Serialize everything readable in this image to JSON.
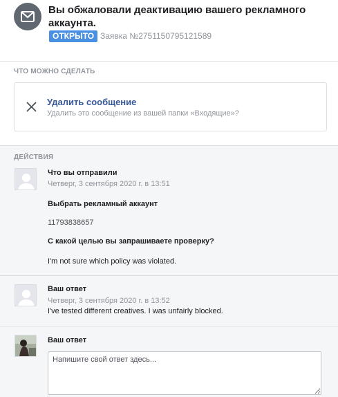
{
  "header": {
    "title": "Вы обжаловали деактивацию вашего рекламного аккаунта.",
    "status": "ОТКРЫТО",
    "ticket_id": "Заявка №2751150795121589",
    "icon": "envelope-icon"
  },
  "what_to_do": {
    "section_label": "ЧТО МОЖНО СДЕЛАТЬ",
    "action_title": "Удалить сообщение",
    "action_description": "Удалить это сообщение из вашей папки «Входящие»?",
    "icon": "close-icon"
  },
  "actions": {
    "section_label": "ДЕЙСТВИЯ",
    "messages": [
      {
        "author": "Что вы отправили",
        "time": "Четверг, 3 сентября 2020 г. в 13:51",
        "field_label": "Выбрать рекламный аккаунт",
        "account_id": "11793838657",
        "question": "С какой целью вы запрашиваете проверку?",
        "answer": "I'm not sure which policy was violated."
      },
      {
        "author": "Ваш ответ",
        "time": "Четверг, 3 сентября 2020 г. в 13:52",
        "text": "I've tested different creatives. I was unfairly blocked."
      }
    ],
    "reply": {
      "label": "Ваш ответ",
      "placeholder": "Напишите свой ответ здесь..."
    }
  },
  "colors": {
    "status_badge": "#4a90e2",
    "link": "#365899",
    "muted": "#90949c",
    "actions_background": "#f5f6f7"
  }
}
